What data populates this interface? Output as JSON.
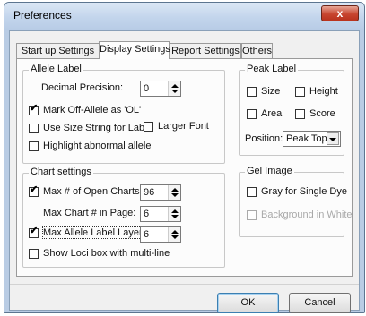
{
  "window": {
    "title": "Preferences",
    "close_glyph": "x"
  },
  "tabs": [
    {
      "label": "Start up Settings",
      "active": false
    },
    {
      "label": "Display Settings",
      "active": true
    },
    {
      "label": "Report Settings",
      "active": false
    },
    {
      "label": "Others",
      "active": false
    }
  ],
  "allele_label": {
    "title": "Allele Label",
    "decimal_precision_label": "Decimal Precision:",
    "decimal_precision_value": "0",
    "mark_off_allele_label": "Mark Off-Allele as 'OL'",
    "mark_off_allele_checked": true,
    "use_size_string_label": "Use Size String for Label",
    "use_size_string_checked": false,
    "larger_font_label": "Larger Font",
    "larger_font_checked": false,
    "highlight_abnormal_label": "Highlight abnormal allele",
    "highlight_abnormal_checked": false
  },
  "chart_settings": {
    "title": "Chart settings",
    "max_open_charts_label": "Max # of Open Charts:",
    "max_open_charts_checked": true,
    "max_open_charts_value": "96",
    "max_chart_in_page_label": "Max Chart # in Page:",
    "max_chart_in_page_value": "6",
    "max_allele_layers_label": "Max Allele Label Layers:",
    "max_allele_layers_checked": true,
    "max_allele_layers_value": "6",
    "show_loci_box_label": "Show Loci box with multi-line",
    "show_loci_box_checked": false
  },
  "peak_label": {
    "title": "Peak Label",
    "size_label": "Size",
    "height_label": "Height",
    "area_label": "Area",
    "score_label": "Score",
    "position_label": "Position:",
    "position_value": "Peak Top"
  },
  "gel_image": {
    "title": "Gel Image",
    "gray_single_dye_label": "Gray for Single Dye",
    "background_white_label": "Background in White"
  },
  "buttons": {
    "ok": "OK",
    "cancel": "Cancel"
  },
  "check_glyph": "✔"
}
